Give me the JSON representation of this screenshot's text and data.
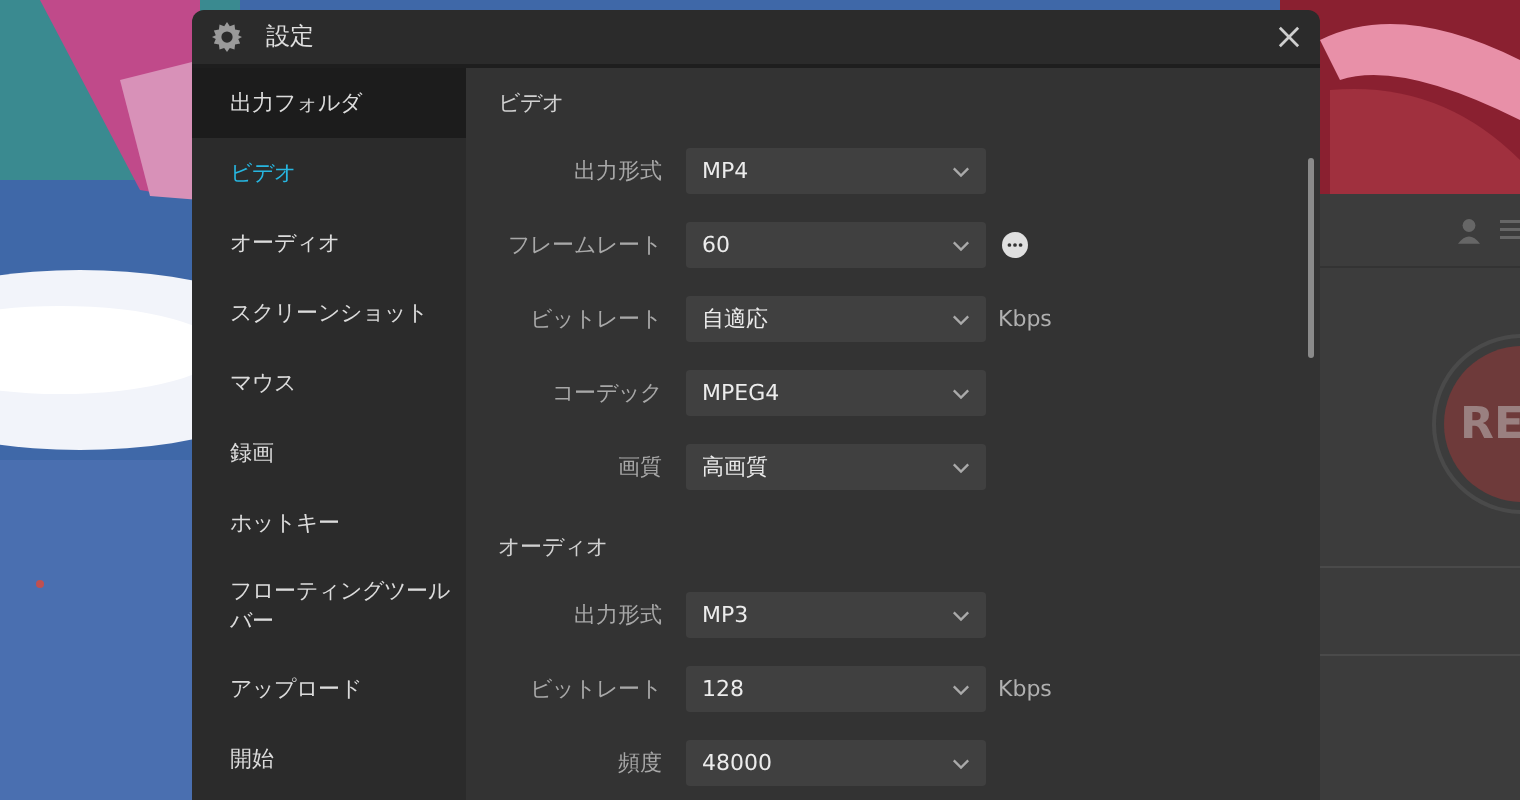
{
  "window": {
    "title": "設定"
  },
  "sidebar": {
    "items": [
      {
        "label": "出力フォルダ",
        "selected": false,
        "hovered": true
      },
      {
        "label": "ビデオ",
        "selected": true,
        "hovered": false
      },
      {
        "label": "オーディオ",
        "selected": false,
        "hovered": false
      },
      {
        "label": "スクリーンショット",
        "selected": false,
        "hovered": false
      },
      {
        "label": "マウス",
        "selected": false,
        "hovered": false
      },
      {
        "label": "録画",
        "selected": false,
        "hovered": false
      },
      {
        "label": "ホットキー",
        "selected": false,
        "hovered": false
      },
      {
        "label": "フローティングツールバー",
        "selected": false,
        "hovered": false
      },
      {
        "label": "アップロード",
        "selected": false,
        "hovered": false
      },
      {
        "label": "開始",
        "selected": false,
        "hovered": false
      }
    ]
  },
  "sections": [
    {
      "heading": "ビデオ",
      "rows": [
        {
          "label": "出力形式",
          "value": "MP4"
        },
        {
          "label": "フレームレート",
          "value": "60",
          "more_button": true
        },
        {
          "label": "ビットレート",
          "value": "自適応",
          "unit": "Kbps"
        },
        {
          "label": "コーデック",
          "value": "MPEG4"
        },
        {
          "label": "画質",
          "value": "高画質"
        }
      ]
    },
    {
      "heading": "オーディオ",
      "rows": [
        {
          "label": "出力形式",
          "value": "MP3"
        },
        {
          "label": "ビットレート",
          "value": "128",
          "unit": "Kbps"
        },
        {
          "label": "頻度",
          "value": "48000"
        }
      ]
    }
  ],
  "background_app": {
    "record_button": "RE"
  }
}
